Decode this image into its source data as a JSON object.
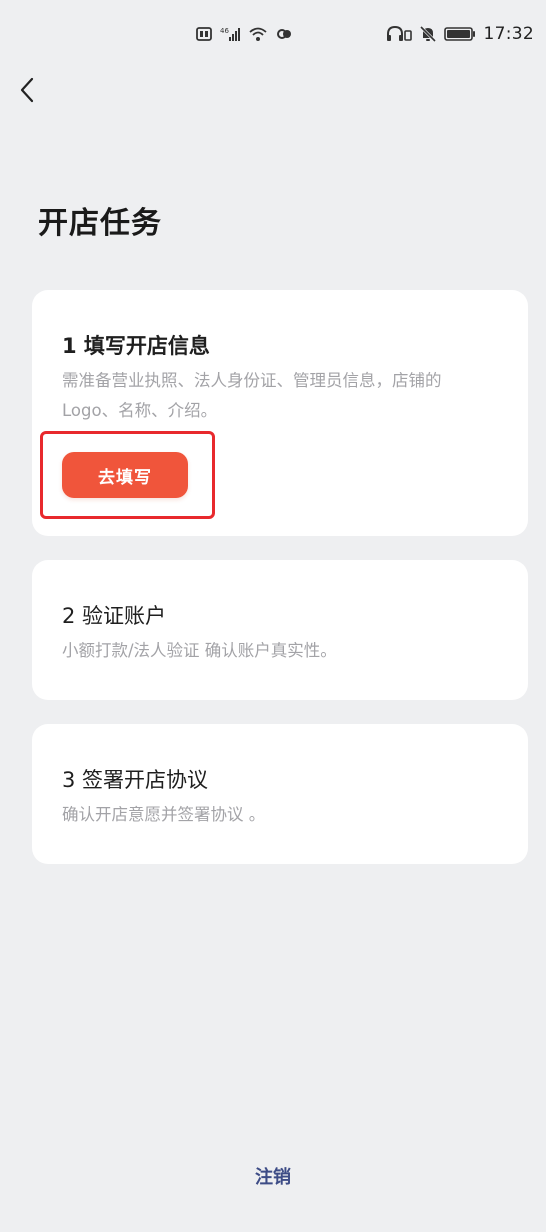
{
  "status_bar": {
    "time": "17:32",
    "left_icons": [
      "sim-card-icon",
      "signal-icon",
      "wifi-icon",
      "link-icon"
    ],
    "right_icons": [
      "headphones-icon",
      "mute-icon",
      "battery-icon"
    ]
  },
  "nav": {
    "back_icon": "chevron-left-icon"
  },
  "page": {
    "title": "开店任务"
  },
  "tasks": [
    {
      "title": "1 填写开店信息",
      "description": "需准备营业执照、法人身份证、管理员信息，店铺的Logo、名称、介绍。",
      "button_label": "去填写",
      "highlight_color": "#e8292d"
    },
    {
      "title": "2 验证账户",
      "description": "小额打款/法人验证 确认账户真实性。"
    },
    {
      "title": "3 签署开店协议",
      "description": "确认开店意愿并签署协议 。"
    }
  ],
  "footer": {
    "logout_label": "注销"
  },
  "colors": {
    "background": "#eeeff1",
    "card": "#ffffff",
    "accent_button": "#f0553b",
    "link": "#3d4c86",
    "description_text": "#a3a3a7"
  }
}
